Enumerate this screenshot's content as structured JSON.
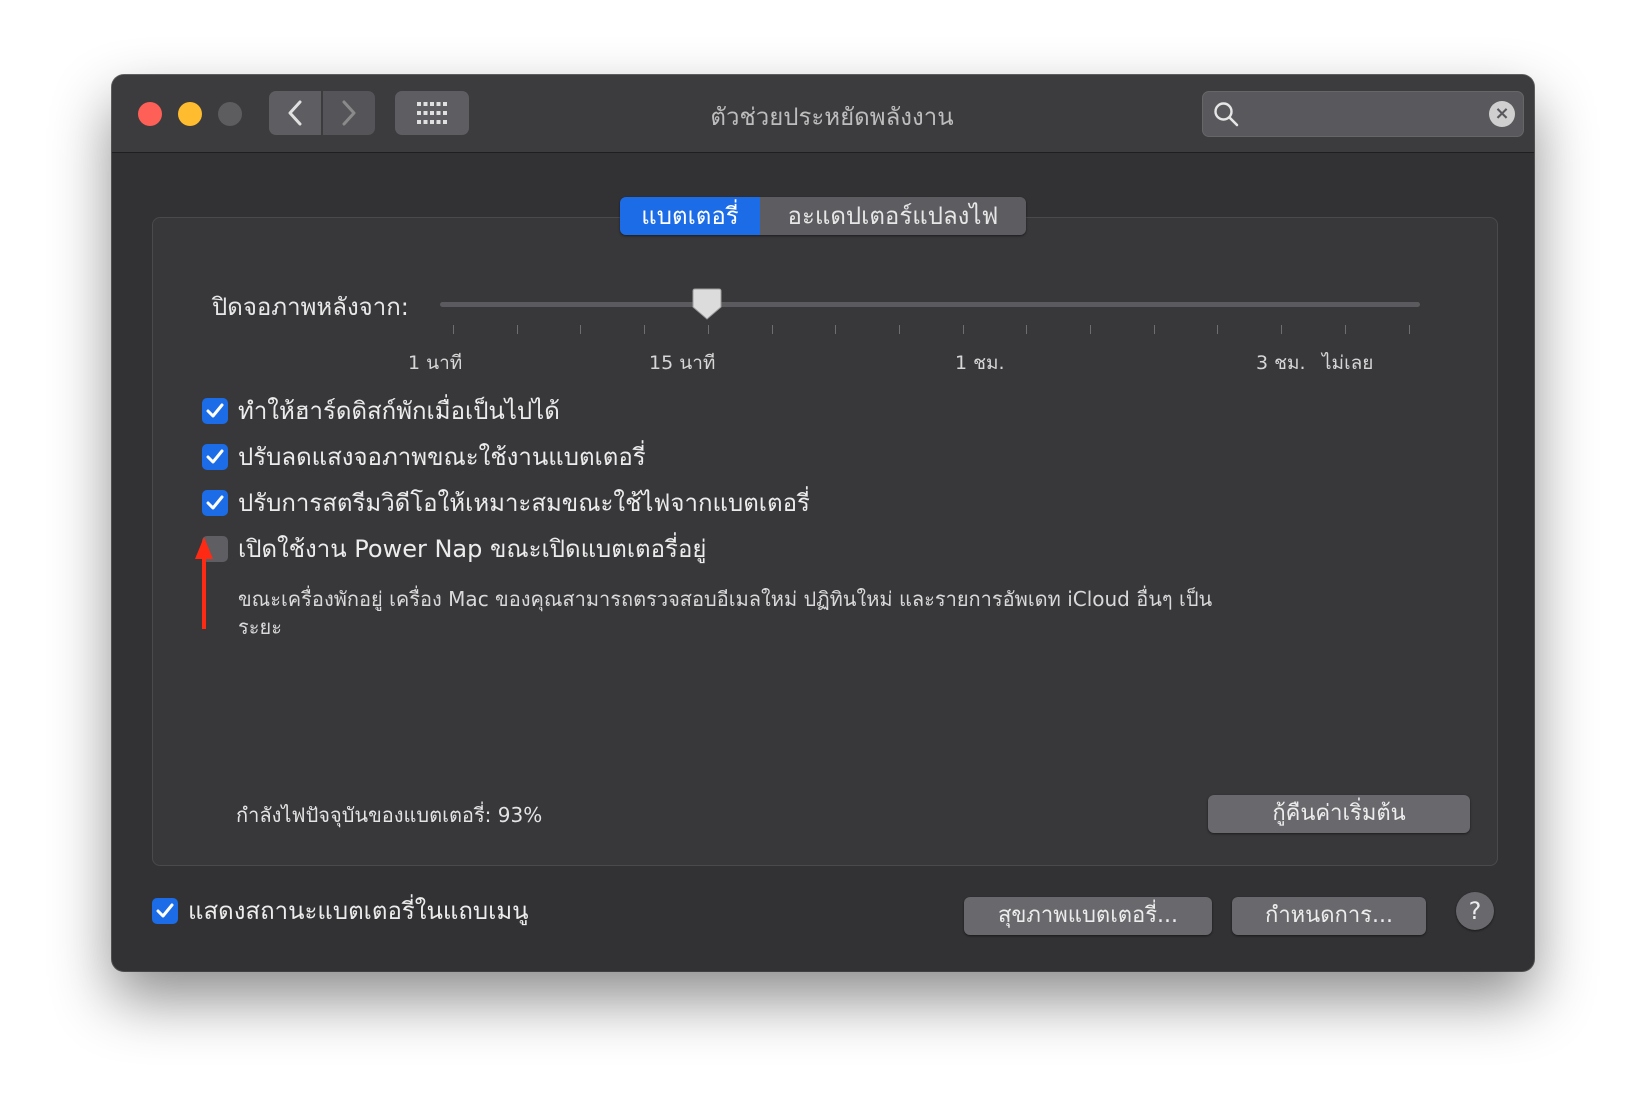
{
  "window": {
    "title": "ตัวช่วยประหยัดพลังงาน"
  },
  "search": {
    "value": "",
    "placeholder": ""
  },
  "tabs": [
    {
      "label": "แบตเตอรี่",
      "active": true
    },
    {
      "label": "อะแดปเตอร์แปลงไฟ",
      "active": false
    }
  ],
  "display_sleep": {
    "label": "ปิดจอภาพหลังจาก:",
    "value": "15 นาที",
    "tick_labels": [
      "1 นาที",
      "15 นาที",
      "1 ชม.",
      "3 ชม.",
      "ไม่เลย"
    ]
  },
  "options": [
    {
      "label": "ทำให้ฮาร์ดดิสก์พักเมื่อเป็นไปได้",
      "checked": true
    },
    {
      "label": "ปรับลดแสงจอภาพขณะใช้งานแบตเตอรี่",
      "checked": true
    },
    {
      "label": "ปรับการสตรีมวิดีโอให้เหมาะสมขณะใช้ไฟจากแบตเตอรี่",
      "checked": true
    },
    {
      "label": "เปิดใช้งาน Power Nap ขณะเปิดแบตเตอรี่อยู่",
      "checked": false
    }
  ],
  "power_nap_description": "ขณะเครื่องพักอยู่ เครื่อง Mac ของคุณสามารถตรวจสอบอีเมลใหม่ ปฏิทินใหม่ และรายการอัพเดท iCloud อื่นๆ เป็นระยะ",
  "battery_level": "กำลังไฟปัจจุบันของแบตเตอรี่: 93%",
  "buttons": {
    "restore_defaults": "กู้คืนค่าเริ่มต้น",
    "battery_health": "สุขภาพแบตเตอรี่...",
    "schedule": "กำหนดการ...",
    "help": "?"
  },
  "menu_bar_option": {
    "label": "แสดงสถานะแบตเตอรี่ในแถบเมนู",
    "checked": true
  },
  "colors": {
    "accent": "#1b6ce6",
    "annotation_arrow": "#ff2a14",
    "close": "#fe5f57",
    "minimize": "#febc2e"
  }
}
